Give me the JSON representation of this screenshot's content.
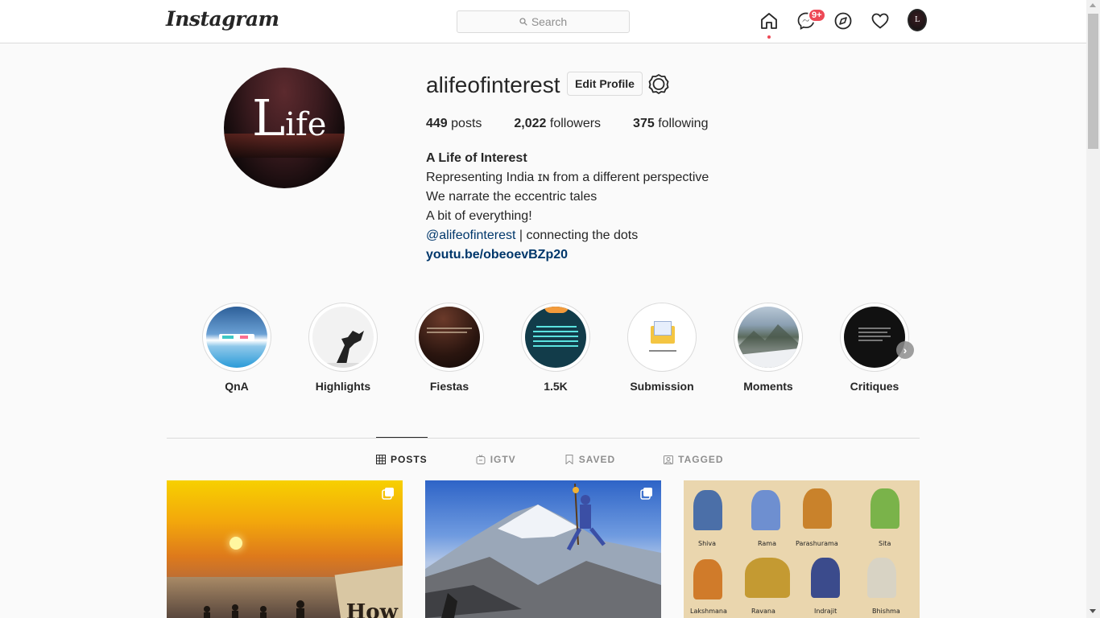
{
  "nav": {
    "logo": "Instagram",
    "search_placeholder": "Search",
    "messages_badge": "9+"
  },
  "profile": {
    "username": "alifeofinterest",
    "edit_button": "Edit Profile",
    "avatar_text_big": "L",
    "avatar_text_small": "ife",
    "stats": [
      {
        "count": "449",
        "label": "posts"
      },
      {
        "count": "2,022",
        "label": "followers"
      },
      {
        "count": "375",
        "label": "following"
      }
    ],
    "bio": {
      "name": "A Life of Interest",
      "line1": "Representing India ɪɴ from a different perspective",
      "line2": "We narrate the eccentric tales",
      "line3": "A bit of everything!",
      "mention": "@alifeofinterest",
      "line4_rest": " | connecting the dots",
      "link": "youtu.be/obeoevBZp20"
    }
  },
  "highlights": [
    {
      "label": "QnA"
    },
    {
      "label": "Highlights"
    },
    {
      "label": "Fiestas"
    },
    {
      "label": "1.5K"
    },
    {
      "label": "Submission"
    },
    {
      "label": "Moments"
    },
    {
      "label": "Critiques"
    }
  ],
  "tabs": [
    {
      "label": "POSTS",
      "icon": "grid-icon"
    },
    {
      "label": "IGTV",
      "icon": "igtv-icon"
    },
    {
      "label": "SAVED",
      "icon": "bookmark-icon"
    },
    {
      "label": "TAGGED",
      "icon": "tag-icon"
    }
  ],
  "posts": {
    "post1_text": "How",
    "post3_captions": [
      "Shiva",
      "Rama",
      "Parashurama",
      "Sita",
      "Lakshmana",
      "Ravana",
      "Indrajit",
      "Bhishma"
    ]
  },
  "colors": {
    "accent_link": "#00376b",
    "badge": "#ed4956",
    "border": "#dbdbdb"
  }
}
